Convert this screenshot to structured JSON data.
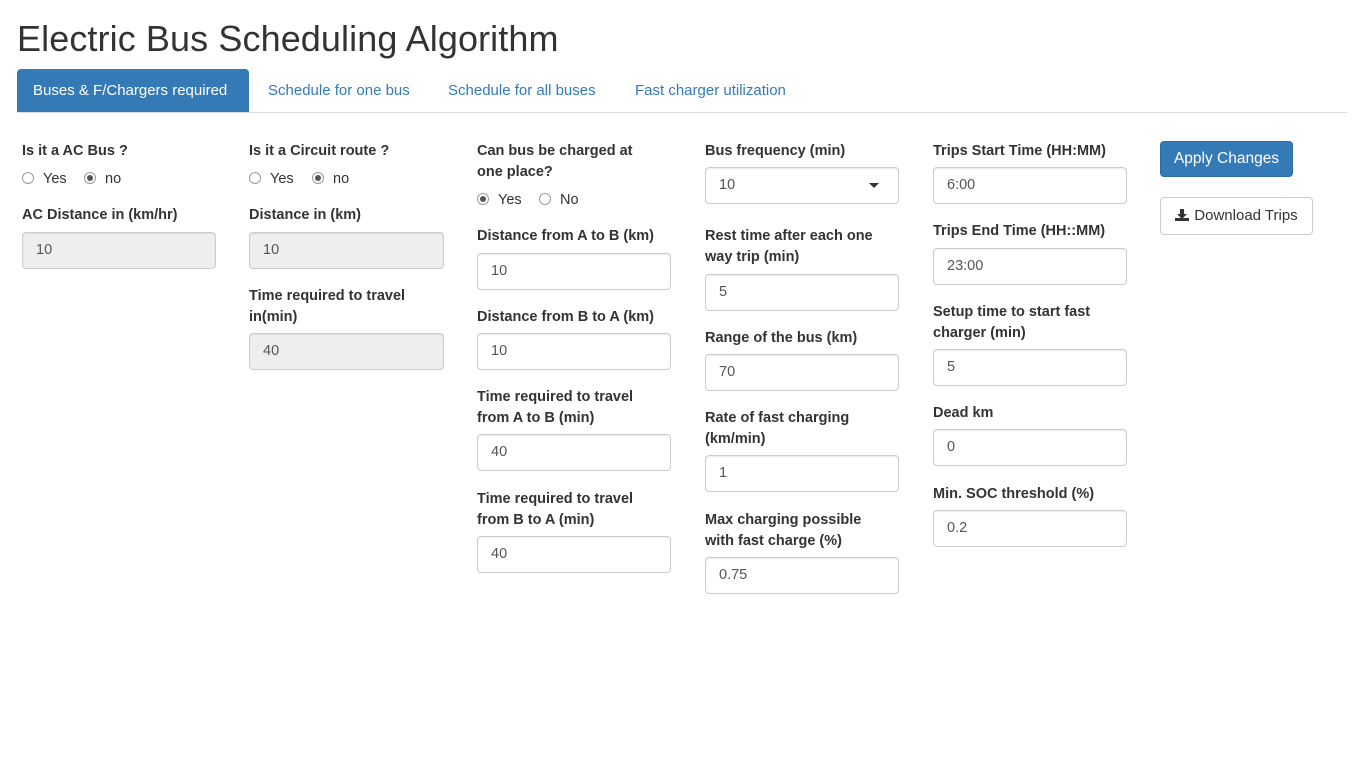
{
  "app": {
    "title": "Electric Bus Scheduling Algorithm"
  },
  "tabs": [
    {
      "label": "Buses & F/Chargers required",
      "active": true
    },
    {
      "label": "Schedule for one bus",
      "active": false
    },
    {
      "label": "Schedule for all buses",
      "active": false
    },
    {
      "label": "Fast charger utilization",
      "active": false
    }
  ],
  "col1": {
    "ac_bus_label": "Is it a AC Bus ?",
    "ac_bus_options": [
      {
        "label": "Yes",
        "checked": false
      },
      {
        "label": "no",
        "checked": true
      }
    ],
    "ac_distance_label": "AC Distance in (km/hr)",
    "ac_distance_value": "10"
  },
  "col2": {
    "circuit_label": "Is it a Circuit route ?",
    "circuit_options": [
      {
        "label": "Yes",
        "checked": false
      },
      {
        "label": "no",
        "checked": true
      }
    ],
    "distance_label": "Distance in (km)",
    "distance_value": "10",
    "time_label_line1": "Time required to travel",
    "time_label_line2": "in(min)",
    "time_value": "40"
  },
  "col3": {
    "charge_place_label_line1": "Can bus be charged at",
    "charge_place_label_line2": "one place?",
    "charge_place_options": [
      {
        "label": "Yes",
        "checked": true
      },
      {
        "label": "No",
        "checked": false
      }
    ],
    "dist_ab_label": "Distance from A to B (km)",
    "dist_ab_value": "10",
    "dist_ba_label": "Distance from B to A (km)",
    "dist_ba_value": "10",
    "time_ab_label_line1": "Time required to travel",
    "time_ab_label_line2": "from A to B (min)",
    "time_ab_value": "40",
    "time_ba_label_line1": "Time required to travel",
    "time_ba_label_line2": "from B to A (min)",
    "time_ba_value": "40"
  },
  "col4": {
    "frequency_label": "Bus frequency (min)",
    "frequency_value": "10",
    "rest_label_line1": "Rest time after each one",
    "rest_label_line2": "way trip (min)",
    "rest_value": "5",
    "range_label": "Range of the bus (km)",
    "range_value": "70",
    "rate_label_line1": "Rate of fast charging",
    "rate_label_line2": "(km/min)",
    "rate_value": "1",
    "max_charge_label_line1": "Max charging possible",
    "max_charge_label_line2": "with fast charge (%)",
    "max_charge_value": "0.75"
  },
  "col5": {
    "start_label": "Trips Start Time (HH:MM)",
    "start_value": "6:00",
    "end_label": "Trips End Time (HH::MM)",
    "end_value": "23:00",
    "setup_label_line1": "Setup time to start fast",
    "setup_label_line2": "charger (min)",
    "setup_value": "5",
    "dead_km_label": "Dead km",
    "dead_km_value": "0",
    "soc_label": "Min. SOC threshold (%)",
    "soc_value": "0.2"
  },
  "actions": {
    "apply_label": "Apply Changes",
    "download_label": "Download Trips",
    "download_icon": "download-icon"
  },
  "colors": {
    "primary": "#337ab7",
    "border": "#cccccc",
    "disabled_bg": "#eeeeee"
  }
}
